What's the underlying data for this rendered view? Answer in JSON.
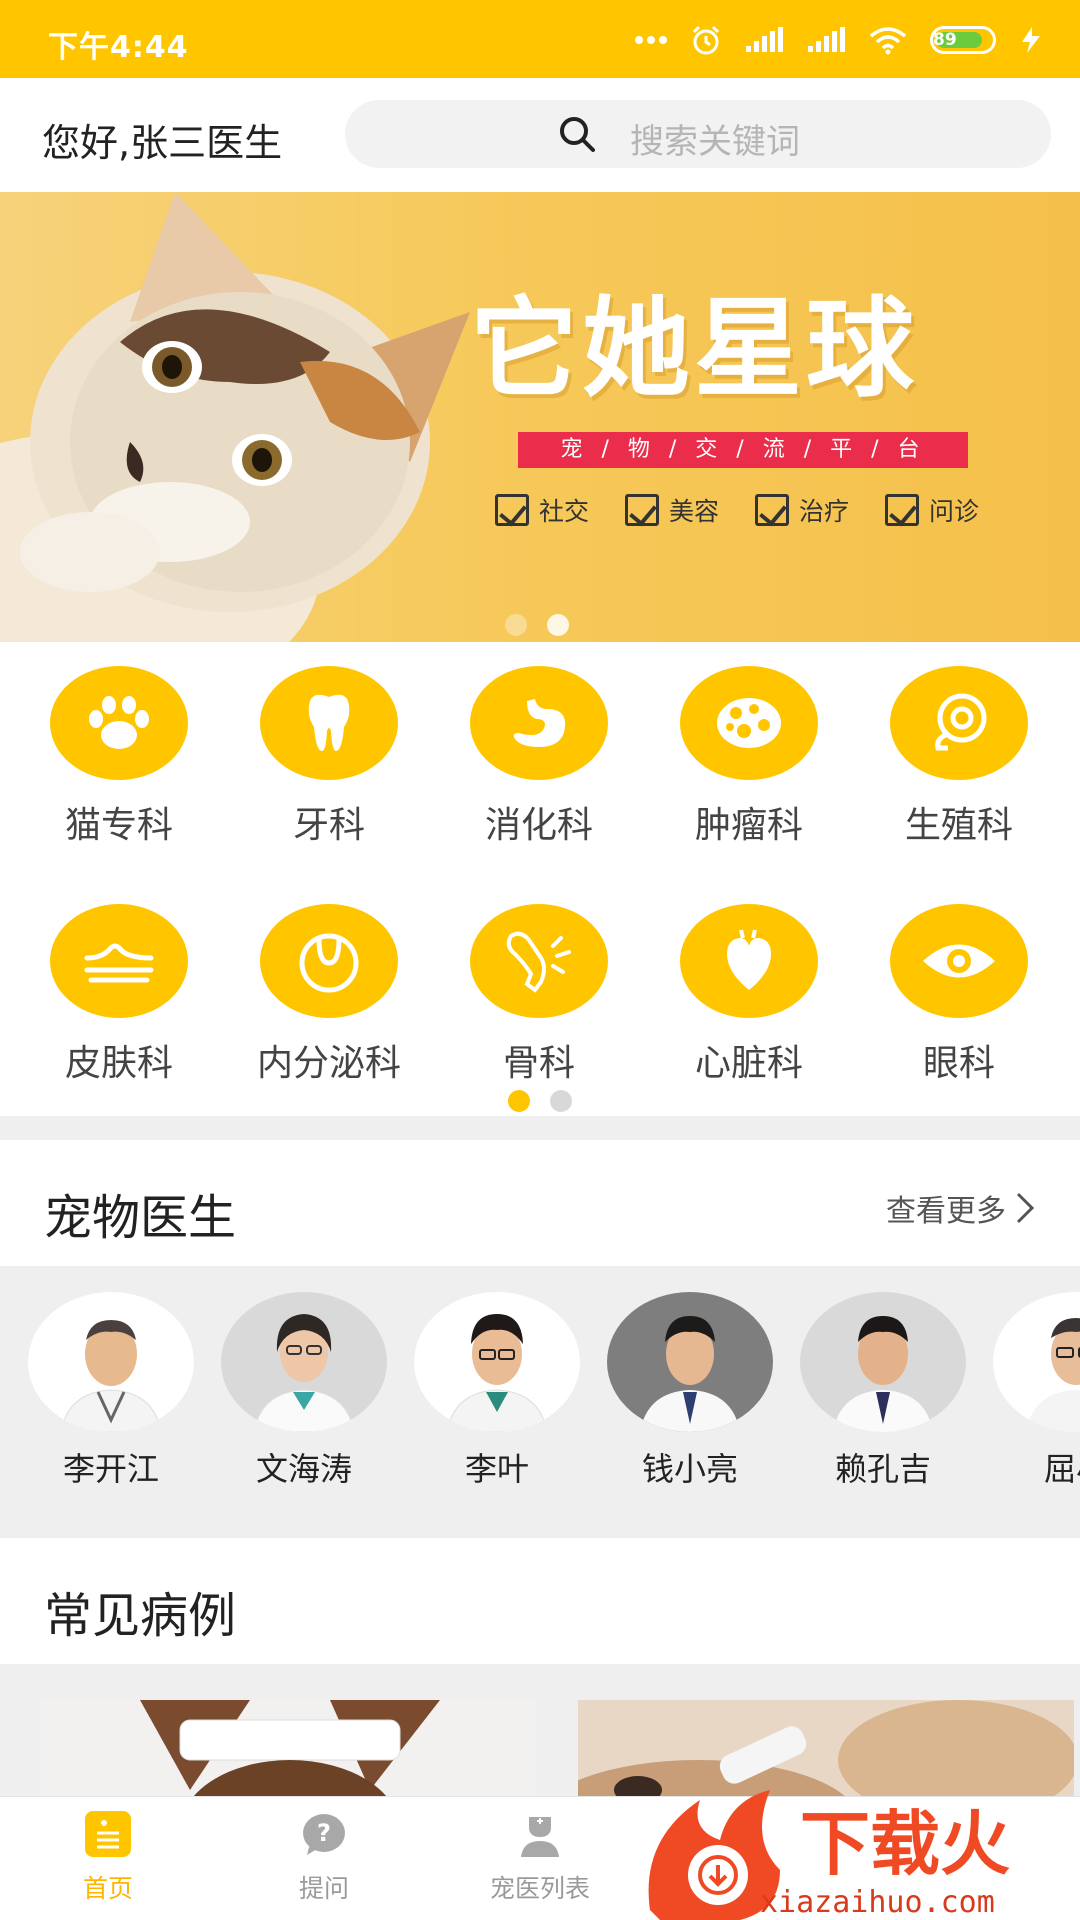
{
  "status_bar": {
    "time": "下午4:44",
    "battery": "89"
  },
  "header": {
    "greeting": "您好,张三医生",
    "search_placeholder": "搜索关键词"
  },
  "banner": {
    "title": "它她星球",
    "subtitle": "宠 / 物 / 交 / 流 / 平 / 台",
    "tags": [
      "社交",
      "美容",
      "治疗",
      "问诊"
    ]
  },
  "categories": [
    {
      "label": "猫专科",
      "icon": "paw-icon"
    },
    {
      "label": "牙科",
      "icon": "tooth-icon"
    },
    {
      "label": "消化科",
      "icon": "stomach-icon"
    },
    {
      "label": "肿瘤科",
      "icon": "tumor-icon"
    },
    {
      "label": "生殖科",
      "icon": "reproductive-icon"
    },
    {
      "label": "皮肤科",
      "icon": "skin-icon"
    },
    {
      "label": "内分泌科",
      "icon": "endocrine-icon"
    },
    {
      "label": "骨科",
      "icon": "bone-icon"
    },
    {
      "label": "心脏科",
      "icon": "heart-icon"
    },
    {
      "label": "眼科",
      "icon": "eye-icon"
    }
  ],
  "doctors_section": {
    "title": "宠物医生",
    "more": "查看更多"
  },
  "doctors": [
    {
      "name": "李开江"
    },
    {
      "name": "文海涛"
    },
    {
      "name": "李叶"
    },
    {
      "name": "钱小亮"
    },
    {
      "name": "赖孔吉"
    },
    {
      "name": "屈小"
    }
  ],
  "cases_section": {
    "title": "常见病例"
  },
  "bottom_nav": [
    {
      "label": "首页",
      "icon": "home-icon",
      "active": true
    },
    {
      "label": "提问",
      "icon": "question-icon",
      "active": false
    },
    {
      "label": "宠医列表",
      "icon": "doctor-list-icon",
      "active": false
    }
  ],
  "watermark": {
    "text": "下载火",
    "url": "xiazaihuo.com"
  },
  "colors": {
    "accent": "#FFC600",
    "banner_red": "#E92D4B",
    "nav_active": "#FFB400"
  }
}
